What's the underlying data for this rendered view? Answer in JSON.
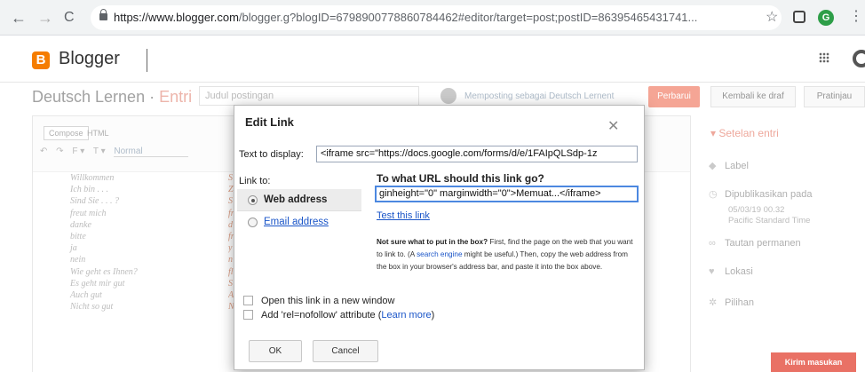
{
  "browser": {
    "url_domain": "https://www.blogger.com",
    "url_rest": "/blogger.g?blogID=6798900778860784462#editor/target=post;postID=86395465431741...",
    "profile_initial": "G"
  },
  "app": {
    "logo_letter": "B",
    "name": "Blogger"
  },
  "post": {
    "blog_name": "Deutsch Lernen",
    "separator": " · ",
    "entry_label": "Entri",
    "title_placeholder": "Judul postingan",
    "publishing_as": "Memposting sebagai Deutsch Lernent",
    "publish_label": "Perbarui",
    "revert_label": "Kembali ke draf",
    "preview_label": "Pratinjau"
  },
  "editor": {
    "tab_compose": "Compose",
    "tab_html": "HTML",
    "toolbar_undo": "↶",
    "toolbar_redo": "↷",
    "toolbar_font": "F ▾",
    "toolbar_size": "T ▾",
    "toolbar_format": "Normal",
    "left_column": [
      "Willkommen",
      "Ich bin . . .",
      "Sind Sie . . . ?",
      "freut mich",
      "danke",
      "bitte",
      "ja",
      "nein",
      "Wie geht es Ihnen?",
      "Es geht mir gut",
      "Auch gut",
      "Nicht so gut"
    ],
    "mid_column": [
      "S",
      "Z",
      "S",
      "fr",
      "d",
      "fr",
      "y",
      "n",
      "fl",
      "S",
      "A",
      "N"
    ]
  },
  "sidebar": {
    "heading": "Setelan entri",
    "label": "Label",
    "published": "Dipublikasikan pada",
    "date": "05/03/19 00.32",
    "timezone": "Pacific Standard Time",
    "permalink": "Tautan permanen",
    "location": "Lokasi",
    "options": "Pilihan",
    "feedback": "Kirim masukan"
  },
  "dialog": {
    "title": "Edit Link",
    "text_to_display_label": "Text to display:",
    "text_to_display_value": "<iframe src=\"https://docs.google.com/forms/d/e/1FAIpQLSdp-1z",
    "link_to_label": "Link to:",
    "options": [
      "Web address",
      "Email address"
    ],
    "url_question": "To what URL should this link go?",
    "url_value": "ginheight=\"0\" marginwidth=\"0\">Memuat...</iframe>",
    "test_link": "Test this link",
    "help_bold": "Not sure what to put in the box?",
    "help_part1": " First, find the page on the web that you want to link to. (A ",
    "help_link": "search engine",
    "help_part2": " might be useful.) Then, copy the web address from the box in your browser's address bar, and paste it into the box above.",
    "open_new_window": "Open this link in a new window",
    "nofollow_prefix": "Add 'rel=nofollow' attribute (",
    "learn_more": "Learn more",
    "nofollow_suffix": ")",
    "ok": "OK",
    "cancel": "Cancel"
  }
}
